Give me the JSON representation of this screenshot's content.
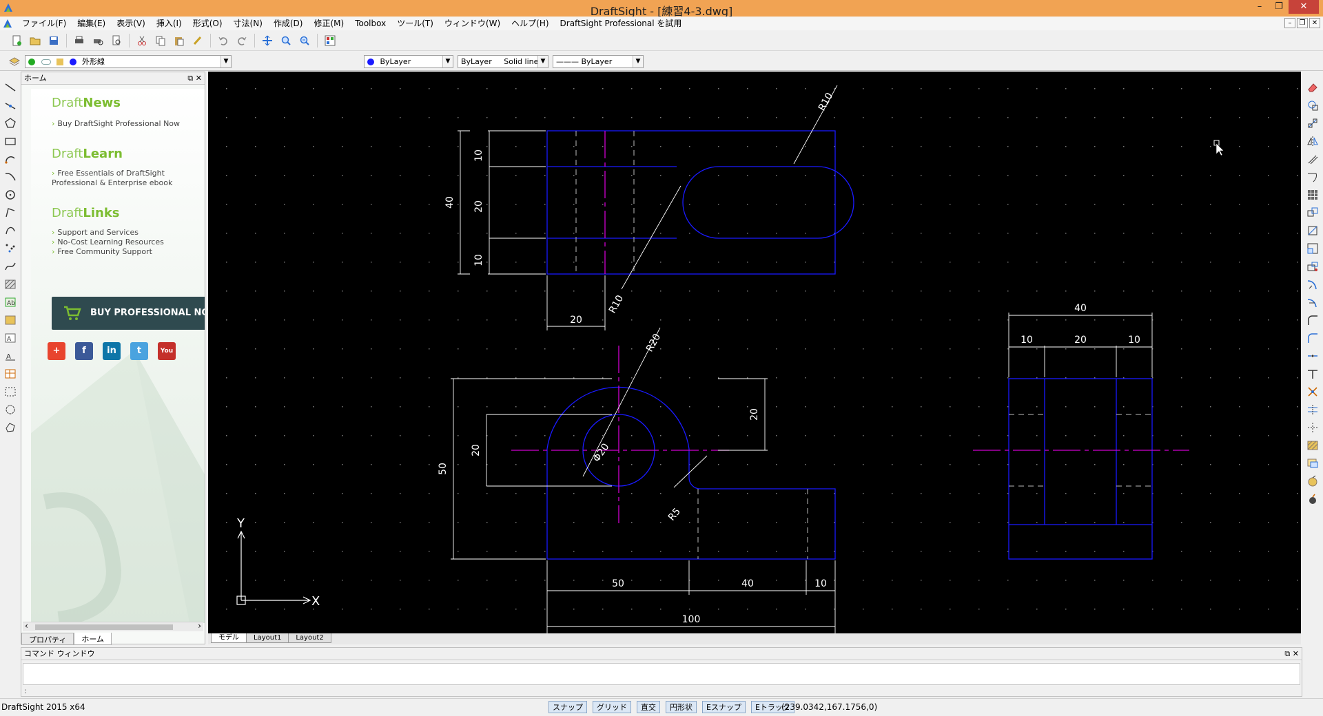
{
  "window": {
    "title": "DraftSight - [練習4-3.dwg]",
    "controls": [
      "–",
      "❐",
      "✕"
    ]
  },
  "menubar": {
    "items": [
      "ファイル(F)",
      "編集(E)",
      "表示(V)",
      "挿入(I)",
      "形式(O)",
      "寸法(N)",
      "作成(D)",
      "修正(M)",
      "Toolbox",
      "ツール(T)",
      "ウィンドウ(W)",
      "ヘルプ(H)",
      "DraftSight Professional を試用"
    ],
    "mdi_controls": [
      "–",
      "❐",
      "✕"
    ]
  },
  "propbar": {
    "layer_name": "外形線",
    "color": "ByLayer",
    "linetype_layer": "ByLayer",
    "linetype": "Solid line",
    "lineweight": "——— ByLayer",
    "layer_dot_color": "#1a1aff",
    "on_dot_color": "#22aa22",
    "color_dot": "#1a1aff"
  },
  "home_panel": {
    "header": "ホーム",
    "header_controls": "⧉ ✕",
    "sections": [
      {
        "title_prefix": "Draft",
        "title_suffix": "News",
        "links": [
          "Buy DraftSight Professional Now"
        ]
      },
      {
        "title_prefix": "Draft",
        "title_suffix": "Learn",
        "links": [
          "Free Essentials of DraftSight Professional & Enterprise ebook"
        ]
      },
      {
        "title_prefix": "Draft",
        "title_suffix": "Links",
        "links": [
          "Support and Services",
          "No-Cost Learning Resources",
          "Free Community Support"
        ]
      }
    ],
    "buy_button": "BUY PROFESSIONAL NOW",
    "social": [
      {
        "name": "add",
        "glyph": "+",
        "color": "#e8442e"
      },
      {
        "name": "facebook",
        "glyph": "f",
        "color": "#3b5998"
      },
      {
        "name": "linkedin",
        "glyph": "in",
        "color": "#0e76a8"
      },
      {
        "name": "twitter",
        "glyph": "t",
        "color": "#4aa3df"
      },
      {
        "name": "youtube",
        "glyph": "You",
        "color": "#c4302b"
      }
    ],
    "tabs": [
      "プロパティ",
      "ホーム"
    ],
    "active_tab": "ホーム"
  },
  "drawing": {
    "dimensions": {
      "top_h_10a": "10",
      "top_h_20": "20",
      "top_h_10b": "10",
      "top_h_40": "40",
      "top_w_20": "20",
      "r10_slot": "R10",
      "r10_arm": "R10",
      "bot_r20": "R20",
      "bot_d20": "Φ20",
      "bot_r5": "R5",
      "bot_h_20l": "20",
      "bot_h_50": "50",
      "bot_h_20r": "20",
      "bot_w_50": "50",
      "bot_w_40": "40",
      "bot_w_10": "10",
      "bot_w_100": "100",
      "side_w_40": "40",
      "side_w_10a": "10",
      "side_w_20": "20",
      "side_w_10b": "10"
    },
    "colors": {
      "outline": "#1a1aff",
      "center": "#d000d0",
      "dim": "#ffffff",
      "grid_dot": "#7a7a7a"
    },
    "ucs": {
      "x_label": "X",
      "y_label": "Y"
    }
  },
  "layout_tabs": [
    "モデル",
    "Layout1",
    "Layout2"
  ],
  "command_window": {
    "title": "コマンド ウィンドウ",
    "controls": "⧉ ✕",
    "prompt": ":"
  },
  "statusbar": {
    "version": "DraftSight 2015 x64",
    "toggles": [
      "スナップ",
      "グリッド",
      "直交",
      "円形状",
      "Eスナップ",
      "Eトラック"
    ],
    "coords": "(239.0342,167.1756,0)"
  }
}
